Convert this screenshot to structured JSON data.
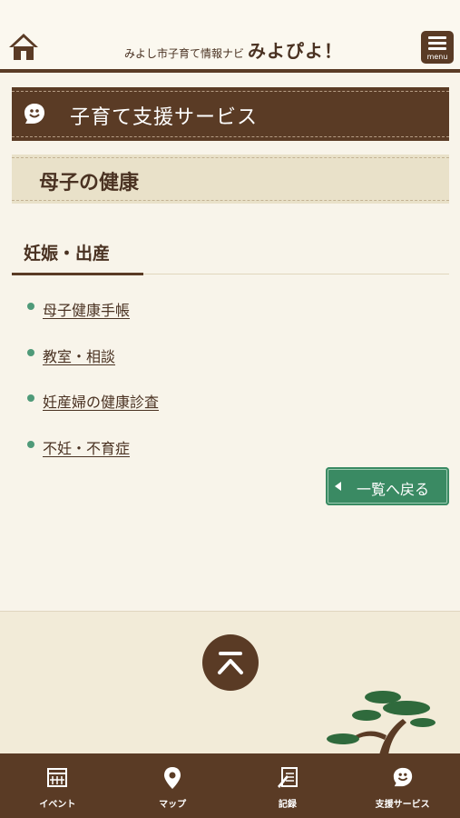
{
  "header": {
    "home_icon": "home-icon",
    "brand_small": "みよし市子育て情報ナビ",
    "brand_large": "みよぴよ！",
    "menu_label": "menu"
  },
  "section": {
    "icon": "support-chat-icon",
    "title": "子育て支援サービス"
  },
  "subsection": {
    "title": "母子の健康"
  },
  "category": {
    "title": "妊娠・出産"
  },
  "links": [
    {
      "label": "母子健康手帳"
    },
    {
      "label": "教室・相談"
    },
    {
      "label": "妊産婦の健康診査"
    },
    {
      "label": "不妊・不育症"
    }
  ],
  "back_button": {
    "label": "一覧へ戻る"
  },
  "tabs": [
    {
      "label": "イベント",
      "icon": "calendar-icon"
    },
    {
      "label": "マップ",
      "icon": "map-pin-icon"
    },
    {
      "label": "記録",
      "icon": "record-note-icon"
    },
    {
      "label": "支援サービス",
      "icon": "support-chat-icon"
    }
  ],
  "colors": {
    "brown": "#5a3b25",
    "green": "#3a8a63",
    "cream": "#f8f4ea"
  }
}
